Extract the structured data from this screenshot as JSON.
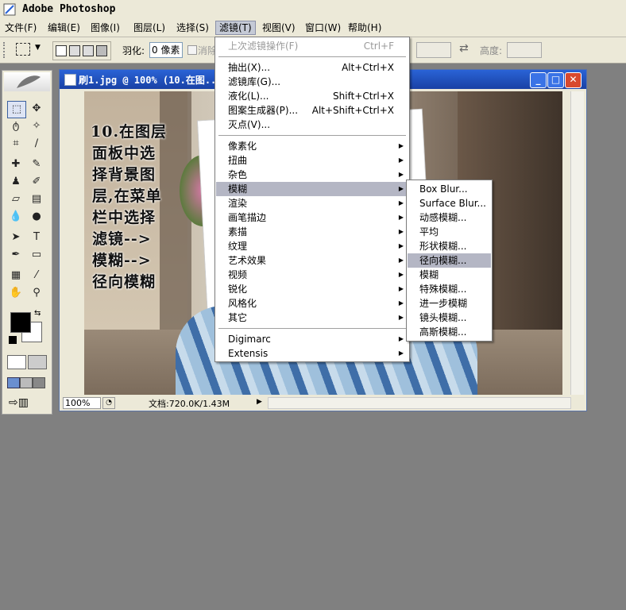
{
  "app": {
    "title": "Adobe Photoshop"
  },
  "menubar": [
    {
      "label": "文件(F)"
    },
    {
      "label": "编辑(E)"
    },
    {
      "label": "图像(I)"
    },
    {
      "label": "图层(L)"
    },
    {
      "label": "选择(S)"
    },
    {
      "label": "滤镜(T)"
    },
    {
      "label": "视图(V)"
    },
    {
      "label": "窗口(W)"
    },
    {
      "label": "帮助(H)"
    }
  ],
  "options": {
    "feather_label": "羽化:",
    "feather_value": "0 像素",
    "antialias_label": "消除",
    "height_label": "高度:"
  },
  "document": {
    "title": "刷1.jpg @ 100% (10.在图... 择 滤镜-->模, RG...",
    "zoom": "100%",
    "doc_size": "文档:720.0K/1.43M",
    "overlay_lines": [
      "10.在图层",
      "面板中选",
      "择背景图",
      "层,在菜单",
      "栏中选择",
      "滤镜-->",
      "模糊-->",
      "径向模糊"
    ]
  },
  "filter_menu": {
    "items": [
      {
        "label": "上次滤镜操作(F)",
        "shortcut": "Ctrl+F",
        "disabled": true
      },
      {
        "label": "抽出(X)...",
        "shortcut": "Alt+Ctrl+X"
      },
      {
        "label": "滤镜库(G)..."
      },
      {
        "label": "液化(L)...",
        "shortcut": "Shift+Ctrl+X"
      },
      {
        "label": "图案生成器(P)...",
        "shortcut": "Alt+Shift+Ctrl+X"
      },
      {
        "label": "灭点(V)..."
      },
      {
        "label": "像素化",
        "submenu": true
      },
      {
        "label": "扭曲",
        "submenu": true
      },
      {
        "label": "杂色",
        "submenu": true
      },
      {
        "label": "模糊",
        "submenu": true,
        "highlighted": true
      },
      {
        "label": "渲染",
        "submenu": true
      },
      {
        "label": "画笔描边",
        "submenu": true
      },
      {
        "label": "素描",
        "submenu": true
      },
      {
        "label": "纹理",
        "submenu": true
      },
      {
        "label": "艺术效果",
        "submenu": true
      },
      {
        "label": "视频",
        "submenu": true
      },
      {
        "label": "锐化",
        "submenu": true
      },
      {
        "label": "风格化",
        "submenu": true
      },
      {
        "label": "其它",
        "submenu": true
      },
      {
        "label": "Digimarc",
        "submenu": true
      },
      {
        "label": "Extensis",
        "submenu": true
      }
    ]
  },
  "blur_submenu": {
    "items": [
      {
        "label": "Box Blur..."
      },
      {
        "label": "Surface Blur..."
      },
      {
        "label": "动感模糊..."
      },
      {
        "label": "平均"
      },
      {
        "label": "形状模糊..."
      },
      {
        "label": "径向模糊...",
        "highlighted": true
      },
      {
        "label": "模糊"
      },
      {
        "label": "特殊模糊..."
      },
      {
        "label": "进一步模糊"
      },
      {
        "label": "镜头模糊..."
      },
      {
        "label": "高斯模糊..."
      }
    ]
  },
  "colors": {
    "accent": "#2a63d6",
    "menu_highlight": "#b4b6c4"
  }
}
